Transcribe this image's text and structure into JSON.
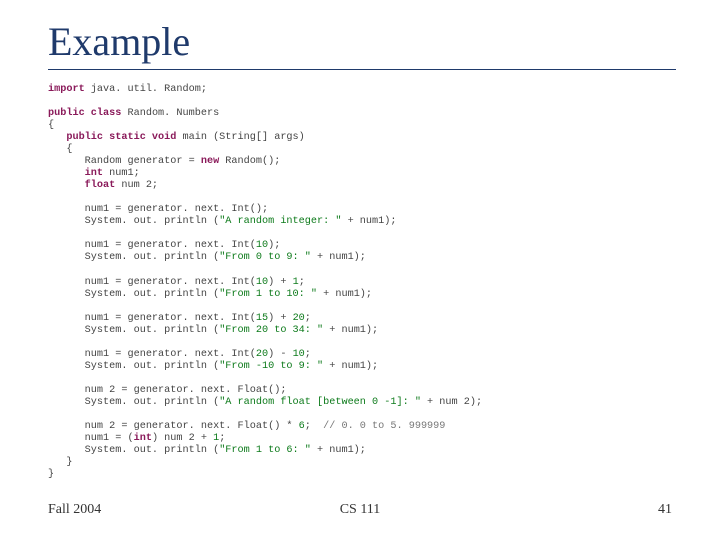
{
  "slide": {
    "title": "Example",
    "code": {
      "l01a": "import",
      "l01b": " java. util. Random;",
      "l02a": "public class",
      "l02b": " Random. Numbers",
      "l03": "{",
      "l04a": "   public static void",
      "l04b": " main (String[] args)",
      "l05": "   {",
      "l06a": "      Random generator = ",
      "l06b": "new",
      "l06c": " Random();",
      "l07a": "      int",
      "l07b": " num1;",
      "l08a": "      float",
      "l08b": " num 2;",
      "l09": "      num1 = generator. next. Int();",
      "l10a": "      System. out. println (",
      "l10b": "\"A random integer: \"",
      "l10c": " + num1);",
      "l11a": "      num1 = generator. next. Int(",
      "l11b": "10",
      "l11c": ");",
      "l12a": "      System. out. println (",
      "l12b": "\"From 0 to 9: \"",
      "l12c": " + num1);",
      "l13a": "      num1 = generator. next. Int(",
      "l13b": "10",
      "l13c": ") + ",
      "l13d": "1",
      "l13e": ";",
      "l14a": "      System. out. println (",
      "l14b": "\"From 1 to 10: \"",
      "l14c": " + num1);",
      "l15a": "      num1 = generator. next. Int(",
      "l15b": "15",
      "l15c": ") + ",
      "l15d": "20",
      "l15e": ";",
      "l16a": "      System. out. println (",
      "l16b": "\"From 20 to 34: \"",
      "l16c": " + num1);",
      "l17a": "      num1 = generator. next. Int(",
      "l17b": "20",
      "l17c": ") - ",
      "l17d": "10",
      "l17e": ";",
      "l18a": "      System. out. println (",
      "l18b": "\"From -10 to 9: \"",
      "l18c": " + num1);",
      "l19": "      num 2 = generator. next. Float();",
      "l20a": "      System. out. println (",
      "l20b": "\"A random float [between 0 -1]: \"",
      "l20c": " + num 2);",
      "l21a": "      num 2 = generator. next. Float() * ",
      "l21b": "6",
      "l21c": ";  ",
      "l21d": "// 0. 0 to 5. 999999",
      "l22a": "      num1 = (",
      "l22b": "int",
      "l22c": ") num 2 + ",
      "l22d": "1",
      "l22e": ";",
      "l23a": "      System. out. println (",
      "l23b": "\"From 1 to 6: \"",
      "l23c": " + num1);",
      "l24": "   }",
      "l25": "}"
    }
  },
  "footer": {
    "left": "Fall 2004",
    "center": "CS 111",
    "right": "41"
  }
}
